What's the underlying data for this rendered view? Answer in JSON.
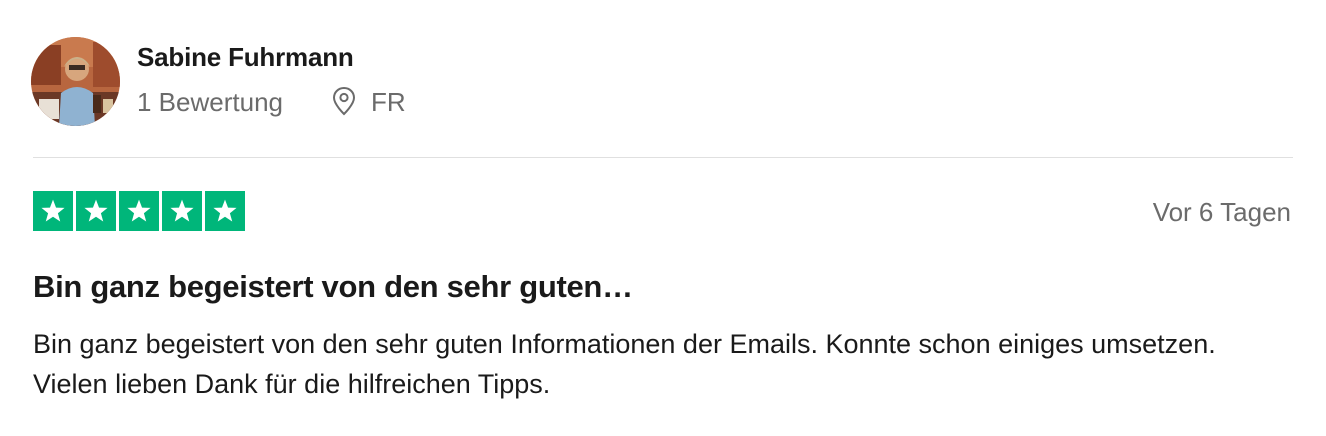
{
  "reviewer": {
    "name": "Sabine Fuhrmann",
    "review_count": "1 Bewertung",
    "location": "FR",
    "avatar_icon": "user-photo"
  },
  "review": {
    "rating": 5,
    "rating_max": 5,
    "star_color": "#00b67a",
    "date": "Vor 6 Tagen",
    "title": "Bin ganz begeistert von den sehr guten…",
    "body": "Bin ganz begeistert von den sehr guten Informationen der Emails. Konnte schon einiges umsetzen. Vielen lieben Dank für die hilfreichen Tipps."
  },
  "colors": {
    "text_primary": "#1a1a1a",
    "text_secondary": "#6b6b6b",
    "divider": "#e0e0e0"
  }
}
